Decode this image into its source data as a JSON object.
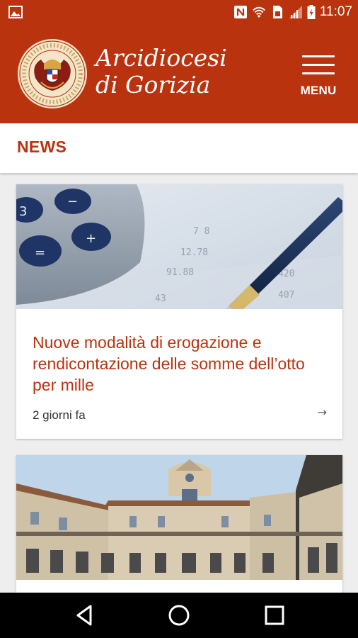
{
  "status_bar": {
    "time": "11:07",
    "icons": [
      "image-icon",
      "nfc-icon",
      "wifi-icon",
      "sim-icon",
      "signal-icon",
      "battery-icon"
    ]
  },
  "header": {
    "brand_line1": "Arcidiocesi",
    "brand_line2": "di Gorizia",
    "menu_label": "MENU",
    "logo": "archdiocese-seal-logo",
    "color": "#b9330f"
  },
  "section": {
    "title": "NEWS"
  },
  "articles": [
    {
      "image": "calculator-and-pen-photo",
      "title": "Nuove modalità di erogazione e rendicontazione delle somme dell’otto per mille",
      "time": "2 giorni fa",
      "arrow": "→"
    },
    {
      "image": "seminary-courtyard-photo",
      "title": "",
      "time": ""
    }
  ],
  "nav": {
    "buttons": [
      "back-icon",
      "home-icon",
      "recents-icon"
    ]
  },
  "colors": {
    "accent": "#b9330f",
    "background": "#eeeeee",
    "card": "#ffffff"
  }
}
